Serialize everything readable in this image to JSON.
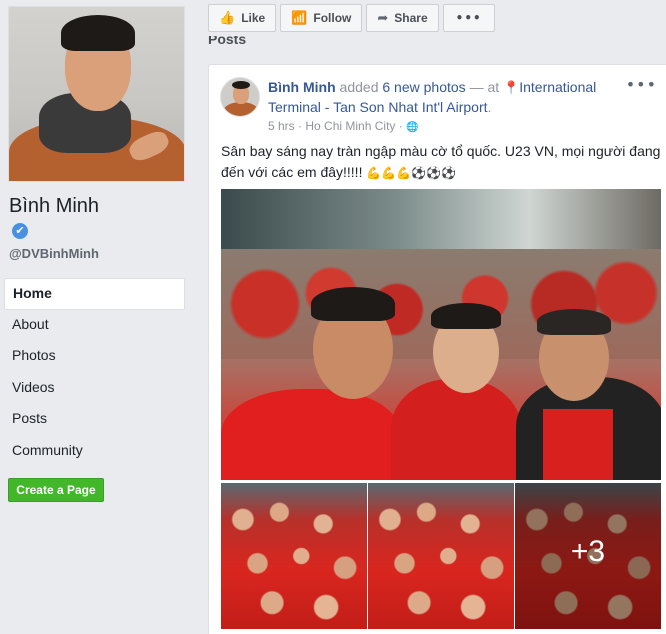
{
  "page": {
    "name": "Bình Minh",
    "verified_icon": "✔",
    "handle": "@DVBinhMinh"
  },
  "nav": {
    "items": [
      {
        "label": "Home",
        "active": true
      },
      {
        "label": "About"
      },
      {
        "label": "Photos"
      },
      {
        "label": "Videos"
      },
      {
        "label": "Posts"
      },
      {
        "label": "Community"
      }
    ],
    "create_page": "Create a Page"
  },
  "actions": {
    "like": {
      "label": "Like",
      "icon": "thumbs-up-icon",
      "glyph": "👍"
    },
    "follow": {
      "label": "Follow",
      "icon": "rss-icon",
      "glyph": "📶"
    },
    "share": {
      "label": "Share",
      "icon": "share-arrow-icon",
      "glyph": "➦"
    },
    "more": {
      "glyph": "•••",
      "icon": "more-icon"
    }
  },
  "section_label": "Posts",
  "post": {
    "author": "Bình Minh",
    "added": "added",
    "photos_link": "6 new photos",
    "dash_at": "— at",
    "location_icon": "📍",
    "location": "International Terminal - Tan Son Nhat Int'l Airport",
    "period": ".",
    "time": "5 hrs",
    "separator": "·",
    "city": "Ho Chi Minh City",
    "audience_icon": "globe-icon",
    "audience_glyph": "🌐",
    "menu_glyph": "•••",
    "text": "Sân bay sáng nay tràn ngập màu cờ tổ quốc. U23 VN, mọi người đang đến với các em đây!!!!! ",
    "emojis": "💪💪💪⚽⚽⚽",
    "more_photos": "+3"
  },
  "colors": {
    "link": "#365899",
    "create_button": "#42b72a",
    "verified": "#4a90e2",
    "background": "#e9ebee"
  }
}
